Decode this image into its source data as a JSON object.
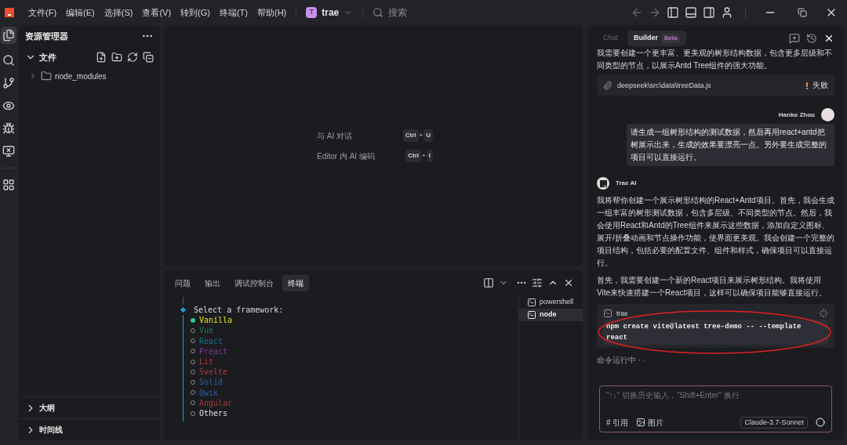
{
  "menu": [
    "文件(F)",
    "编辑(E)",
    "选择(S)",
    "查看(V)",
    "转到(G)",
    "终端(T)",
    "帮助(H)"
  ],
  "project": {
    "initial": "T",
    "name": "trae"
  },
  "search": {
    "placeholder": "搜索"
  },
  "explorer": {
    "title": "资源管理器",
    "section": "文件",
    "items": [
      {
        "name": "node_modules",
        "expanded": false
      }
    ],
    "bottom_sections": [
      {
        "label": "大纲",
        "expanded": false
      },
      {
        "label": "时间线",
        "expanded": false
      }
    ]
  },
  "editor": {
    "shortcuts": [
      {
        "label": "与 AI 对话",
        "keys": [
          "Ctrl",
          "U"
        ],
        "separator": "+"
      },
      {
        "label": "Editor 内 AI 编码",
        "keys": [
          "Ctrl",
          "I"
        ],
        "separator": "+"
      }
    ]
  },
  "panel": {
    "tabs": [
      {
        "label": "问题",
        "selected": false
      },
      {
        "label": "输出",
        "selected": false
      },
      {
        "label": "调试控制台",
        "selected": false
      },
      {
        "label": "终端",
        "selected": true
      }
    ],
    "prompt": "Select a framework:",
    "options": [
      {
        "label": "Vanilla",
        "selected": true,
        "color": "#e5e510"
      },
      {
        "label": "Vue",
        "selected": false,
        "color": "#1f7a4c"
      },
      {
        "label": "React",
        "selected": false,
        "color": "#1f6f8b"
      },
      {
        "label": "Preact",
        "selected": false,
        "color": "#7a3a8f"
      },
      {
        "label": "Lit",
        "selected": false,
        "color": "#a33a3a"
      },
      {
        "label": "Svelte",
        "selected": false,
        "color": "#a33a3a"
      },
      {
        "label": "Solid",
        "selected": false,
        "color": "#2f5ea3"
      },
      {
        "label": "Qwik",
        "selected": false,
        "color": "#2f5ea3"
      },
      {
        "label": "Angular",
        "selected": false,
        "color": "#a33a3a"
      },
      {
        "label": "Others",
        "selected": false,
        "color": "#e5e5e5"
      }
    ],
    "terminals": [
      {
        "name": "powershell",
        "selected": false
      },
      {
        "name": "node",
        "selected": true
      }
    ]
  },
  "chat": {
    "tabs": [
      {
        "label": "Chat",
        "selected": false
      },
      {
        "label": "Builder",
        "selected": true,
        "badge": "Beta"
      }
    ],
    "intro": "我需要创建一个更丰富、更美观的树形结构数据，包含更多层级和不同类型的节点，以展示Antd Tree组件的强大功能。",
    "file": {
      "path": "deepseek\\src\\data\\treeData.js",
      "status": "失败"
    },
    "user": {
      "name": "Hanko Zhou",
      "message": "请生成一组树形结构的测试数据，然后再用react+antd把树展示出来，生成的效果要漂亮一点。另外要生成完整的项目可以直接运行。"
    },
    "assistant": {
      "name": "Trae AI",
      "paragraphs": [
        "我将帮你创建一个展示树形结构的React+Antd项目。首先，我会生成一组丰富的树形测试数据，包含多层级、不同类型的节点。然后，我会使用React和Antd的Tree组件来展示这些数据，添加自定义图标、展开/折叠动画和节点操作功能，使界面更美观。我会创建一个完整的项目结构，包括必要的配置文件、组件和样式，确保项目可以直接运行。",
        "首先，我需要创建一个新的React项目来展示树形结构。我将使用Vite来快速搭建一个React项目，这样可以确保项目能够直接运行。"
      ]
    },
    "command": {
      "shell": "trae",
      "text": "npm create vite@latest tree-demo -- --template react"
    },
    "running": "命令运行中 · ·",
    "input": {
      "placeholder": "\"↑↓\" 切换历史输入，\"Shift+Enter\" 换行",
      "actions": [
        "# 引用",
        "图片"
      ],
      "model": "Claude-3.7-Sonnet"
    }
  }
}
